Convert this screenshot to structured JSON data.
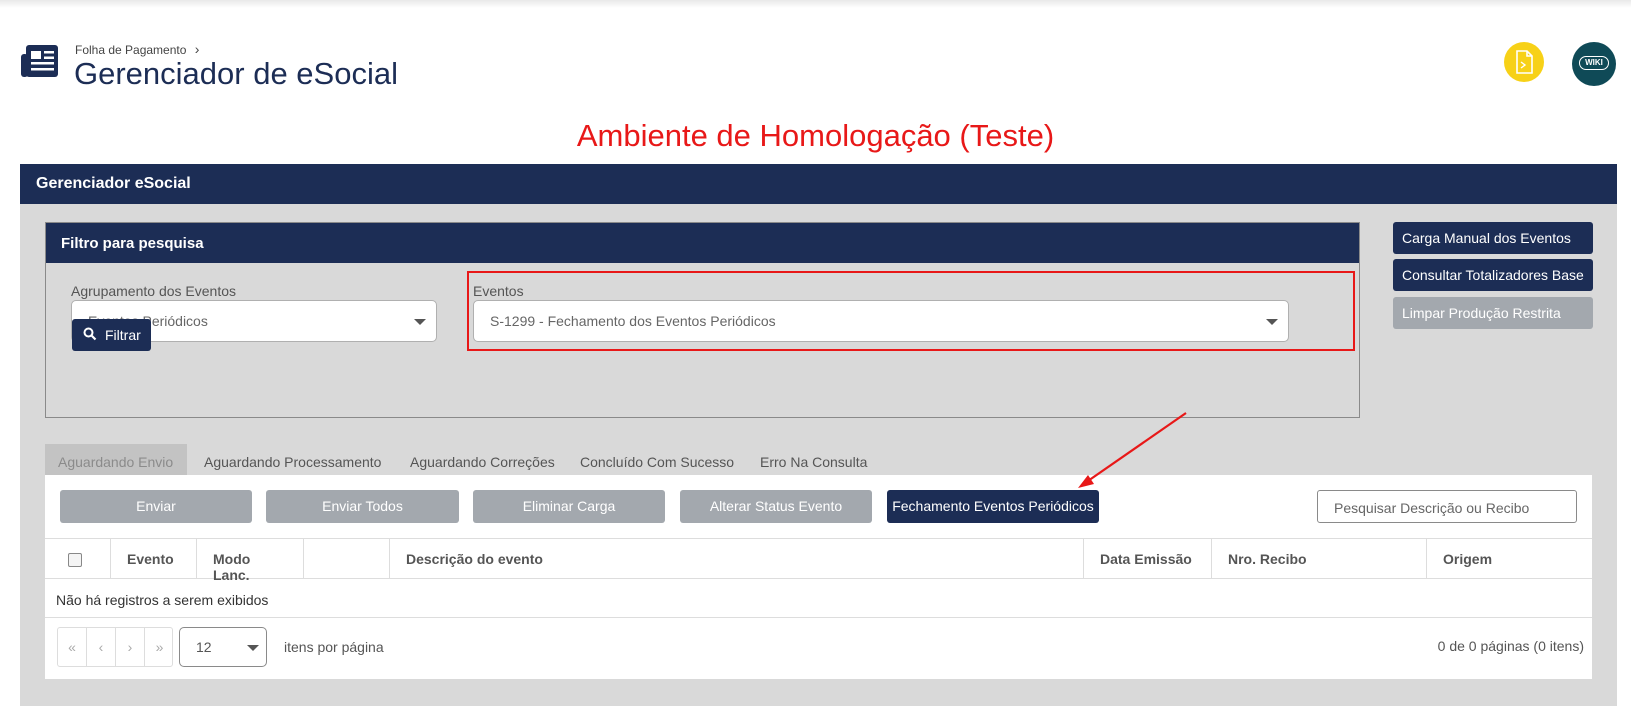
{
  "header": {
    "breadcrumb": "Folha de Pagamento",
    "breadcrumb_sep": "›",
    "title": "Gerenciador de eSocial",
    "wiki_label": "WIKI"
  },
  "environment_banner": "Ambiente de Homologação (Teste)",
  "card": {
    "title": "Gerenciador eSocial"
  },
  "filter": {
    "title": "Filtro para pesquisa",
    "group_label": "Agrupamento dos Eventos",
    "group_value": "Eventos Periódicos",
    "events_label": "Eventos",
    "events_value": "S-1299 - Fechamento dos Eventos Periódicos",
    "filter_button": "Filtrar"
  },
  "side_buttons": {
    "manual_load": "Carga Manual dos Eventos",
    "totalizers": "Consultar Totalizadores Base",
    "clear_restricted": "Limpar Produção Restrita"
  },
  "tabs": [
    {
      "label": "Aguardando Envio"
    },
    {
      "label": "Aguardando Processamento"
    },
    {
      "label": "Aguardando Correções"
    },
    {
      "label": "Concluído Com Sucesso"
    },
    {
      "label": "Erro Na Consulta"
    }
  ],
  "actions": {
    "send": "Enviar",
    "send_all": "Enviar Todos",
    "remove_load": "Eliminar Carga",
    "change_status": "Alterar Status Evento",
    "close_periodic": "Fechamento Eventos Periódicos",
    "search_placeholder": "Pesquisar Descrição ou Recibo"
  },
  "grid": {
    "columns": [
      "Evento",
      "Modo Lanc.",
      "",
      "Descrição do evento",
      "Data Emissão",
      "Nro. Recibo",
      "Origem"
    ],
    "empty_message": "Não há registros a serem exibidos"
  },
  "pager": {
    "first": "«",
    "prev": "‹",
    "next": "›",
    "last": "»",
    "page_size": "12",
    "per_page_label": "itens por página",
    "info": "0 de 0 páginas (0 itens)"
  },
  "colors": {
    "navy": "#1c2d55",
    "banner_red": "#e81818",
    "pdf_yellow": "#f7d117",
    "wiki_teal": "#0f4a57"
  }
}
